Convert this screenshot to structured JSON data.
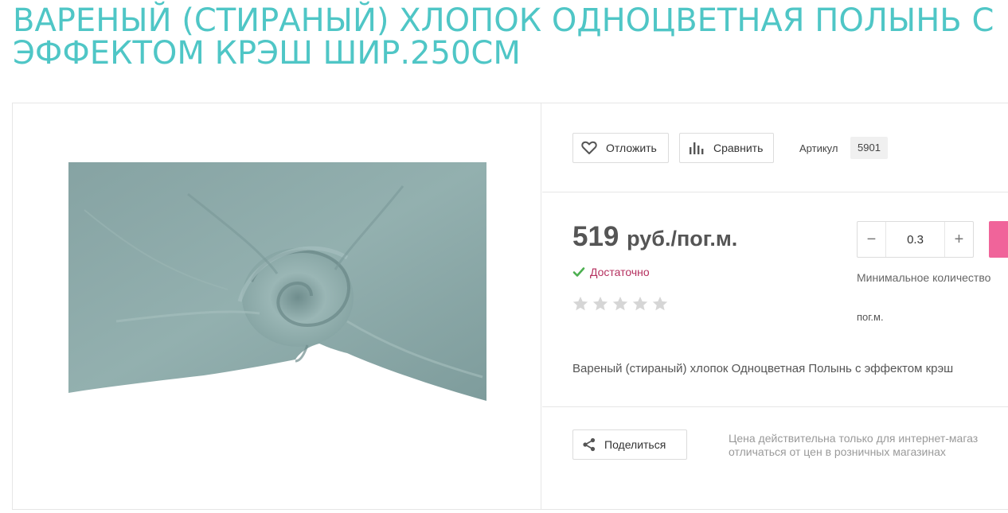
{
  "product": {
    "title": "ВАРЕНЫЙ (СТИРАНЫЙ) ХЛОПОК ОДНОЦВЕТНАЯ ПОЛЫНЬ С ЭФФЕКТОМ КРЭШ ШИР.250СМ",
    "description": "Вареный (стираный) хлопок Одноцветная Полынь с эффектом крэш"
  },
  "actions": {
    "save_label": "Отложить",
    "compare_label": "Сравнить",
    "share_label": "Поделиться"
  },
  "sku": {
    "label": "Артикул",
    "value": "5901"
  },
  "price": {
    "amount": "519",
    "unit": "руб./пог.м."
  },
  "stock": {
    "status": "Достаточно"
  },
  "rating": {
    "stars": 0,
    "max": 5
  },
  "quantity": {
    "value": "0.3",
    "minus_symbol": "−",
    "plus_symbol": "+",
    "min_label": "Минимальное количество",
    "unit": "пог.м."
  },
  "notes": {
    "price_note_line1": "Цена действительна только для интернет-магаз",
    "price_note_line2": "отличаться от цен в розничных магазинах"
  },
  "icons": {
    "save": "heart-icon",
    "compare": "bar-chart-icon",
    "share": "share-icon",
    "stock": "check-icon",
    "star": "star-icon"
  },
  "colors": {
    "title": "#4fc6c6",
    "cart_button": "#f0649a",
    "stock_text": "#b5305f",
    "check": "#4caf50",
    "star_empty": "#d6d6d6",
    "fabric": "#8fabab"
  }
}
